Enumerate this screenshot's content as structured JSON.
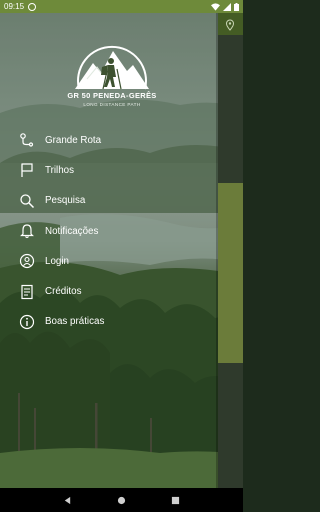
{
  "status_bar": {
    "time": "09:15",
    "app_icon": "app-notification-icon",
    "right_icons": [
      "wifi-icon",
      "signal-icon",
      "battery-icon"
    ]
  },
  "logo": {
    "title": "GR 50 PENEDA-GERÊS",
    "subtitle": "LONG DISTANCE PATH"
  },
  "menu": {
    "items": [
      {
        "label": "Grande Rota",
        "icon": "route-icon"
      },
      {
        "label": "Trilhos",
        "icon": "flag-icon"
      },
      {
        "label": "Pesquisa",
        "icon": "search-icon"
      },
      {
        "label": "Notificações",
        "icon": "bell-icon"
      },
      {
        "label": "Login",
        "icon": "user-circle-icon"
      },
      {
        "label": "Créditos",
        "icon": "document-icon"
      },
      {
        "label": "Boas práticas",
        "icon": "info-icon"
      }
    ]
  },
  "nav_bar": {
    "buttons": [
      "back-icon",
      "home-icon",
      "recents-icon"
    ]
  },
  "colors": {
    "status_bar": "#6e8a3a",
    "menu_text": "#ffffff"
  }
}
